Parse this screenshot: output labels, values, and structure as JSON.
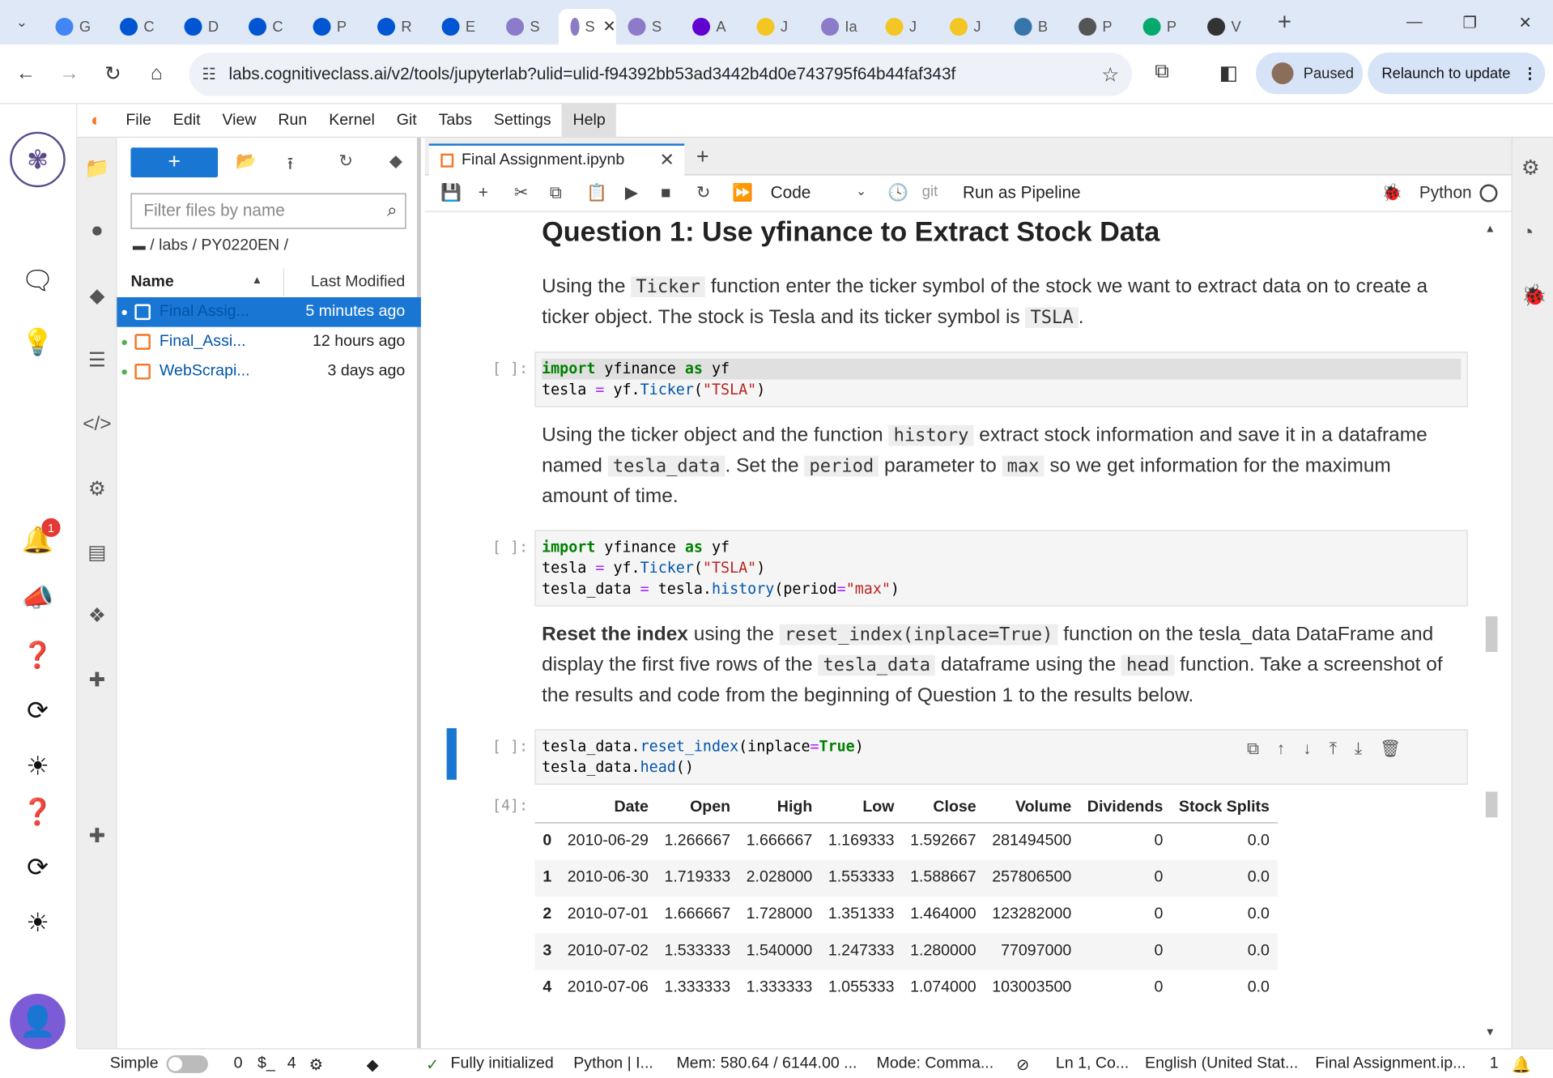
{
  "browser": {
    "tabs": [
      {
        "label": "G",
        "icon": "google-icon",
        "color": "#4285f4"
      },
      {
        "label": "C",
        "icon": "coursera-icon",
        "color": "#0056d2"
      },
      {
        "label": "D",
        "icon": "coursera-icon",
        "color": "#0056d2"
      },
      {
        "label": "C",
        "icon": "coursera-icon",
        "color": "#0056d2"
      },
      {
        "label": "P",
        "icon": "coursera-icon",
        "color": "#0056d2"
      },
      {
        "label": "R",
        "icon": "coursera-icon",
        "color": "#0056d2"
      },
      {
        "label": "E",
        "icon": "coursera-icon",
        "color": "#0056d2"
      },
      {
        "label": "S",
        "icon": "skills-icon",
        "color": "#8b7bc8"
      },
      {
        "label": "S",
        "icon": "skills-icon",
        "color": "#8b7bc8",
        "active": true
      },
      {
        "label": "S",
        "icon": "skills-icon",
        "color": "#8b7bc8"
      },
      {
        "label": "A",
        "icon": "yahoo-icon",
        "color": "#6001d2"
      },
      {
        "label": "J",
        "icon": "jupyter-icon",
        "color": "#f3c623"
      },
      {
        "label": "Ia",
        "icon": "skills-icon",
        "color": "#8b7bc8"
      },
      {
        "label": "J",
        "icon": "jupyter-icon",
        "color": "#f3c623"
      },
      {
        "label": "J",
        "icon": "jupyter-icon",
        "color": "#f3c623"
      },
      {
        "label": "B",
        "icon": "python-icon",
        "color": "#3776ab"
      },
      {
        "label": "P",
        "icon": "globe-icon",
        "color": "#555555"
      },
      {
        "label": "P",
        "icon": "w3schools-icon",
        "color": "#04aa6d"
      },
      {
        "label": "V",
        "icon": "wikipedia-icon",
        "color": "#333333"
      }
    ],
    "url": "labs.cognitiveclass.ai/v2/tools/jupyterlab?ulid=ulid-f94392bb53ad3442b4d0e743795f64b44faf343f",
    "profile_label": "Paused",
    "relaunch_label": "Relaunch to update"
  },
  "rail": {
    "notification_count": "1"
  },
  "menu": [
    "File",
    "Edit",
    "View",
    "Run",
    "Kernel",
    "Git",
    "Tabs",
    "Settings",
    "Help"
  ],
  "filebrowser": {
    "filter_placeholder": "Filter files by name",
    "breadcrumb": "/ labs / PY0220EN /",
    "col_name": "Name",
    "col_modified": "Last Modified",
    "files": [
      {
        "name": "Final Assig...",
        "modified": "5 minutes ago",
        "selected": true
      },
      {
        "name": "Final_Assi...",
        "modified": "12 hours ago"
      },
      {
        "name": "WebScrapi...",
        "modified": "3 days ago"
      }
    ]
  },
  "notebook": {
    "tab_title": "Final Assignment.ipynb",
    "cell_type": "Code",
    "git_label": "git",
    "pipeline_label": "Run as Pipeline",
    "kernel_name": "Python"
  },
  "cells": {
    "heading": "Question 1: Use yfinance to Extract Stock Data",
    "md1": {
      "t1": "Using the",
      "c1": "Ticker",
      "t2": "function enter the ticker symbol of the stock we want to extract data on to create a ticker object. The stock is Tesla and its ticker symbol is",
      "c2": "TSLA",
      "t3": "."
    },
    "prompt1": "[ ]:",
    "md2": {
      "t1": "Using the ticker object and the function",
      "c1": "history",
      "t2": "extract stock information and save it in a dataframe named",
      "c2": "tesla_data",
      "t3": ". Set the",
      "c3": "period",
      "t4": "parameter to",
      "c4": "max",
      "t5": "so we get information for the maximum amount of time."
    },
    "prompt2": "[ ]:",
    "md3": {
      "b1": "Reset the index",
      "t1": "using the",
      "c1": "reset_index(inplace=True)",
      "t2": "function on the tesla_data DataFrame and display the first five rows of the",
      "c2": "tesla_data",
      "t3": "dataframe using the",
      "c3": "head",
      "t4": "function. Take a screenshot of the results and code from the beginning of Question 1 to the results below."
    },
    "prompt3": "[ ]:",
    "out_prompt": "[4]:",
    "table": {
      "columns": [
        "",
        "Date",
        "Open",
        "High",
        "Low",
        "Close",
        "Volume",
        "Dividends",
        "Stock Splits"
      ],
      "rows": [
        [
          "0",
          "2010-06-29",
          "1.266667",
          "1.666667",
          "1.169333",
          "1.592667",
          "281494500",
          "0",
          "0.0"
        ],
        [
          "1",
          "2010-06-30",
          "1.719333",
          "2.028000",
          "1.553333",
          "1.588667",
          "257806500",
          "0",
          "0.0"
        ],
        [
          "2",
          "2010-07-01",
          "1.666667",
          "1.728000",
          "1.351333",
          "1.464000",
          "123282000",
          "0",
          "0.0"
        ],
        [
          "3",
          "2010-07-02",
          "1.533333",
          "1.540000",
          "1.247333",
          "1.280000",
          "77097000",
          "0",
          "0.0"
        ],
        [
          "4",
          "2010-07-06",
          "1.333333",
          "1.333333",
          "1.055333",
          "1.074000",
          "103003500",
          "0",
          "0.0"
        ]
      ]
    }
  },
  "status": {
    "simple": "Simple",
    "terminals": "0",
    "kernels": "4",
    "init": "Fully initialized",
    "kernel": "Python | I...",
    "mem": "Mem: 580.64 / 6144.00 ...",
    "mode": "Mode: Comma...",
    "cursor": "Ln 1, Co...",
    "lang": "English (United Stat...",
    "file": "Final Assignment.ip...",
    "num": "1"
  }
}
